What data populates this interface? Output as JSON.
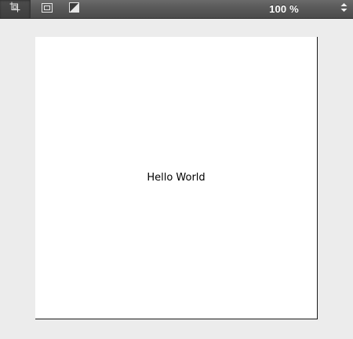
{
  "toolbar": {
    "icons": {
      "crop": "crop-icon",
      "frame": "frame-icon",
      "background": "background-toggle-icon",
      "stepper": "stepper-arrows-icon"
    },
    "zoom_label": "100 %"
  },
  "canvas": {
    "text": "Hello World",
    "background_color": "#ffffff"
  },
  "colors": {
    "toolbar": "#595959",
    "window_background": "#ececec"
  }
}
